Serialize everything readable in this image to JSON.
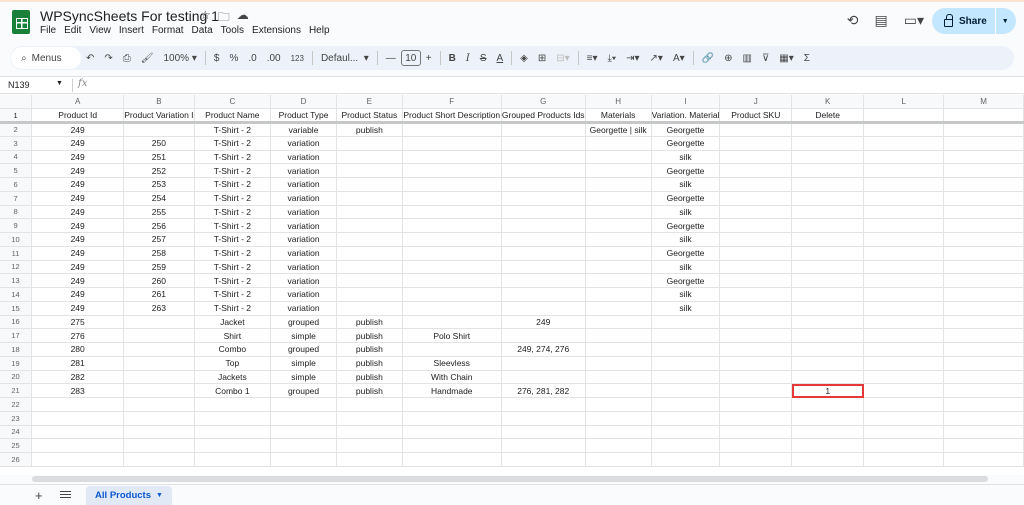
{
  "app": {
    "title": "WPSyncSheets For testing 1",
    "menu": [
      "File",
      "Edit",
      "View",
      "Insert",
      "Format",
      "Data",
      "Tools",
      "Extensions",
      "Help"
    ],
    "share_label": "Share"
  },
  "toolbar": {
    "menus_label": "Menus",
    "zoom": "100%",
    "currency": "$",
    "percent": "%",
    "dec_decrease": ".0",
    "dec_increase": ".00",
    "number_format": "123",
    "font": "Defaul...",
    "font_size": "10"
  },
  "formula_bar": {
    "name_box": "N139",
    "fx": "fx",
    "content": ""
  },
  "grid": {
    "columns": [
      "A",
      "B",
      "C",
      "D",
      "E",
      "F",
      "G",
      "H",
      "I",
      "J",
      "K",
      "L",
      "M"
    ],
    "rows": [
      [
        "1",
        "Product Id",
        "Product Variation I",
        "Product Name",
        "Product Type",
        "Product Status",
        "Product Short Description",
        "Grouped Products Ids",
        "Materials",
        "Variation. Material",
        "Product SKU",
        "Delete",
        "",
        ""
      ],
      [
        "2",
        "249",
        "",
        "T-Shirt - 2",
        "variable",
        "publish",
        "",
        "",
        "Georgette | silk",
        "Georgette",
        "",
        "",
        "",
        ""
      ],
      [
        "3",
        "249",
        "250",
        "T-Shirt - 2",
        "variation",
        "",
        "",
        "",
        "",
        "Georgette",
        "",
        "",
        "",
        ""
      ],
      [
        "4",
        "249",
        "251",
        "T-Shirt - 2",
        "variation",
        "",
        "",
        "",
        "",
        "silk",
        "",
        "",
        "",
        ""
      ],
      [
        "5",
        "249",
        "252",
        "T-Shirt - 2",
        "variation",
        "",
        "",
        "",
        "",
        "Georgette",
        "",
        "",
        "",
        ""
      ],
      [
        "6",
        "249",
        "253",
        "T-Shirt - 2",
        "variation",
        "",
        "",
        "",
        "",
        "silk",
        "",
        "",
        "",
        ""
      ],
      [
        "7",
        "249",
        "254",
        "T-Shirt - 2",
        "variation",
        "",
        "",
        "",
        "",
        "Georgette",
        "",
        "",
        "",
        ""
      ],
      [
        "8",
        "249",
        "255",
        "T-Shirt - 2",
        "variation",
        "",
        "",
        "",
        "",
        "silk",
        "",
        "",
        "",
        ""
      ],
      [
        "9",
        "249",
        "256",
        "T-Shirt - 2",
        "variation",
        "",
        "",
        "",
        "",
        "Georgette",
        "",
        "",
        "",
        ""
      ],
      [
        "10",
        "249",
        "257",
        "T-Shirt - 2",
        "variation",
        "",
        "",
        "",
        "",
        "silk",
        "",
        "",
        "",
        ""
      ],
      [
        "11",
        "249",
        "258",
        "T-Shirt - 2",
        "variation",
        "",
        "",
        "",
        "",
        "Georgette",
        "",
        "",
        "",
        ""
      ],
      [
        "12",
        "249",
        "259",
        "T-Shirt - 2",
        "variation",
        "",
        "",
        "",
        "",
        "silk",
        "",
        "",
        "",
        ""
      ],
      [
        "13",
        "249",
        "260",
        "T-Shirt - 2",
        "variation",
        "",
        "",
        "",
        "",
        "Georgette",
        "",
        "",
        "",
        ""
      ],
      [
        "14",
        "249",
        "261",
        "T-Shirt - 2",
        "variation",
        "",
        "",
        "",
        "",
        "silk",
        "",
        "",
        "",
        ""
      ],
      [
        "15",
        "249",
        "263",
        "T-Shirt - 2",
        "variation",
        "",
        "",
        "",
        "",
        "silk",
        "",
        "",
        "",
        ""
      ],
      [
        "16",
        "275",
        "",
        "Jacket",
        "grouped",
        "publish",
        "",
        "249",
        "",
        "",
        "",
        "",
        "",
        ""
      ],
      [
        "17",
        "276",
        "",
        "Shirt",
        "simple",
        "publish",
        "Polo Shirt",
        "",
        "",
        "",
        "",
        "",
        "",
        ""
      ],
      [
        "18",
        "280",
        "",
        "Combo",
        "grouped",
        "publish",
        "",
        "249, 274, 276",
        "",
        "",
        "",
        "",
        "",
        ""
      ],
      [
        "19",
        "281",
        "",
        "Top",
        "simple",
        "publish",
        "Sleevless",
        "",
        "",
        "",
        "",
        "",
        "",
        ""
      ],
      [
        "20",
        "282",
        "",
        "Jackets",
        "simple",
        "publish",
        "With Chain",
        "",
        "",
        "",
        "",
        "",
        "",
        ""
      ],
      [
        "21",
        "283",
        "",
        "Combo 1",
        "grouped",
        "publish",
        "Handmade",
        "276, 281, 282",
        "",
        "",
        "",
        "1",
        "",
        ""
      ],
      [
        "22",
        "",
        "",
        "",
        "",
        "",
        "",
        "",
        "",
        "",
        "",
        "",
        "",
        ""
      ],
      [
        "23",
        "",
        "",
        "",
        "",
        "",
        "",
        "",
        "",
        "",
        "",
        "",
        "",
        ""
      ],
      [
        "24",
        "",
        "",
        "",
        "",
        "",
        "",
        "",
        "",
        "",
        "",
        "",
        "",
        ""
      ],
      [
        "25",
        "",
        "",
        "",
        "",
        "",
        "",
        "",
        "",
        "",
        "",
        "",
        "",
        ""
      ],
      [
        "26",
        "",
        "",
        "",
        "",
        "",
        "",
        "",
        "",
        "",
        "",
        "",
        "",
        ""
      ]
    ],
    "highlighted_cell": "K21",
    "highlight_color": "#e53935"
  },
  "sheets": {
    "active": "All Products"
  }
}
